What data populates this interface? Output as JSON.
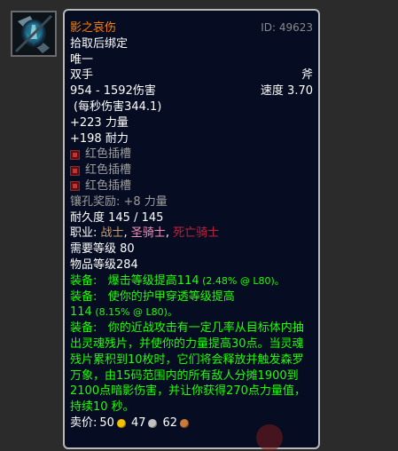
{
  "item": {
    "name": "影之哀伤",
    "id_text": "ID: 49623",
    "bind": "拾取后绑定",
    "unique": "唯一",
    "slot": "双手",
    "type": "斧",
    "damage": "954 - 1592伤害",
    "speed_label": "速度 3.70",
    "dps": "(每秒伤害344.1)",
    "stats": [
      "+223 力量",
      "+198 耐力"
    ],
    "sockets": [
      "红色插槽",
      "红色插槽",
      "红色插槽"
    ],
    "socket_bonus": "镶孔奖励: +8 力量",
    "durability": "耐久度 145 / 145",
    "classes_label": "职业: ",
    "classes": [
      "战士",
      "圣骑士",
      "死亡骑士"
    ],
    "class_separator": ", ",
    "required_level": "需要等级 80",
    "item_level": "物品等级284",
    "equip_lines": [
      {
        "prefix": "装备: ",
        "text": "爆击等级提高114",
        "pct": " (2.48% @ L80)。"
      },
      {
        "prefix": "装备: ",
        "text": "使你的护甲穿透等级提高",
        "text2": "114",
        "pct": " (8.15% @ L80)。"
      },
      {
        "prefix": "装备: ",
        "text": "你的近战攻击有一定几率从目标体内抽出灵魂残片，并使你的力量提高30点。当灵魂残片累积到10枚时，它们将会释放并触发森罗万象，由15码范围内的所有敌人分摊1900到2100点暗影伤害，并让你获得270点力量值，持续10 秒。"
      }
    ],
    "sell_label": "卖价: ",
    "sell_gold": "50",
    "sell_silver": "47",
    "sell_copper": "62"
  },
  "colors": {
    "legendary": "#ff8000",
    "equip_green": "#1eff00",
    "warrior": "#c79c6e",
    "paladin": "#f58cba",
    "death_knight": "#c41f3b",
    "tooltip_bg": "#060d22"
  },
  "icons": [
    "shadowmourne-axe-icon",
    "red-socket-icon",
    "gold-coin-icon",
    "silver-coin-icon",
    "copper-coin-icon"
  ]
}
